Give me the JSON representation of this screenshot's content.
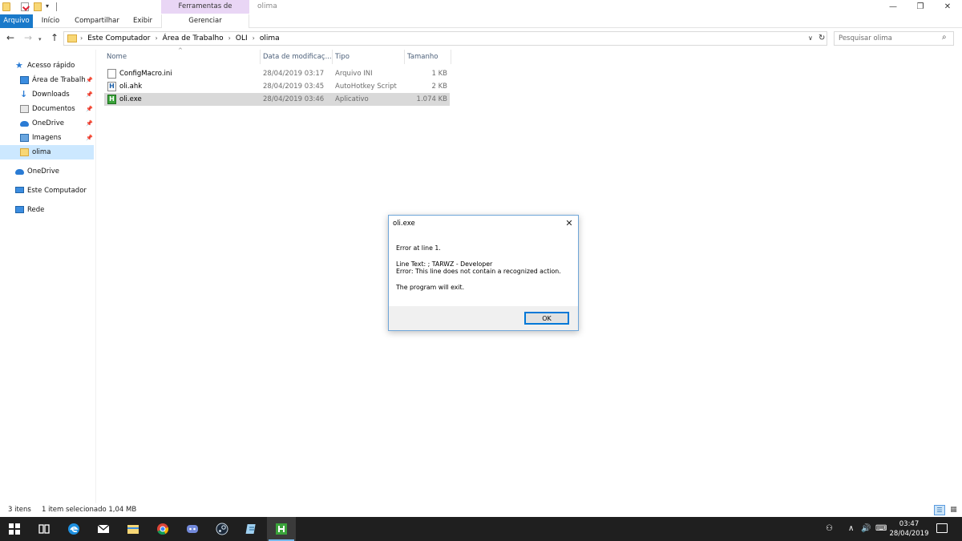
{
  "window": {
    "title": "olima",
    "tools_header": "Ferramentas de Aplicativo",
    "controls": {
      "minimize": "—",
      "maximize": "❐",
      "close": "✕"
    }
  },
  "ribbon": {
    "tabs": [
      "Arquivo",
      "Início",
      "Compartilhar",
      "Exibir",
      "Gerenciar"
    ],
    "accent_color": "#1979ca"
  },
  "address": {
    "crumbs": [
      "Este Computador",
      "Área de Trabalho",
      "OLI",
      "olima"
    ]
  },
  "search": {
    "placeholder": "Pesquisar olima"
  },
  "sidebar": {
    "items": [
      {
        "label": "Acesso rápido",
        "icon": "star-icon"
      },
      {
        "label": "Área de Trabalho",
        "icon": "desktop-icon",
        "pinned": true
      },
      {
        "label": "Downloads",
        "icon": "download-icon",
        "pinned": true
      },
      {
        "label": "Documentos",
        "icon": "documents-icon",
        "pinned": true
      },
      {
        "label": "OneDrive",
        "icon": "onedrive-icon",
        "pinned": true
      },
      {
        "label": "Imagens",
        "icon": "images-icon",
        "pinned": true
      },
      {
        "label": "olima",
        "icon": "folder-icon",
        "selected": true
      },
      {
        "label": "OneDrive",
        "icon": "onedrive-icon"
      },
      {
        "label": "Este Computador",
        "icon": "computer-icon"
      },
      {
        "label": "Rede",
        "icon": "network-icon"
      }
    ]
  },
  "files": {
    "columns": [
      "Nome",
      "Data de modificaç...",
      "Tipo",
      "Tamanho"
    ],
    "rows": [
      {
        "name": "ConfigMacro.ini",
        "date": "28/04/2019 03:17",
        "type": "Arquivo INI",
        "size": "1 KB",
        "icon": "ini-file-icon"
      },
      {
        "name": "oli.ahk",
        "date": "28/04/2019 03:45",
        "type": "AutoHotkey Script",
        "size": "2 KB",
        "icon": "ahk-file-icon"
      },
      {
        "name": "oli.exe",
        "date": "28/04/2019 03:46",
        "type": "Aplicativo",
        "size": "1.074 KB",
        "icon": "exe-file-icon",
        "selected": true
      }
    ]
  },
  "status": {
    "count": "3 itens",
    "selected": "1 item selecionado  1,04 MB"
  },
  "dialog": {
    "title": "oli.exe",
    "line1": "Error at line 1.",
    "line2": "Line Text: ; TARWZ - Developer",
    "line3": "Error: This line does not contain a recognized action.",
    "line4": "The program will exit.",
    "ok_label": "OK"
  },
  "taskbar": {
    "time": "03:47",
    "date": "28/04/2019"
  }
}
